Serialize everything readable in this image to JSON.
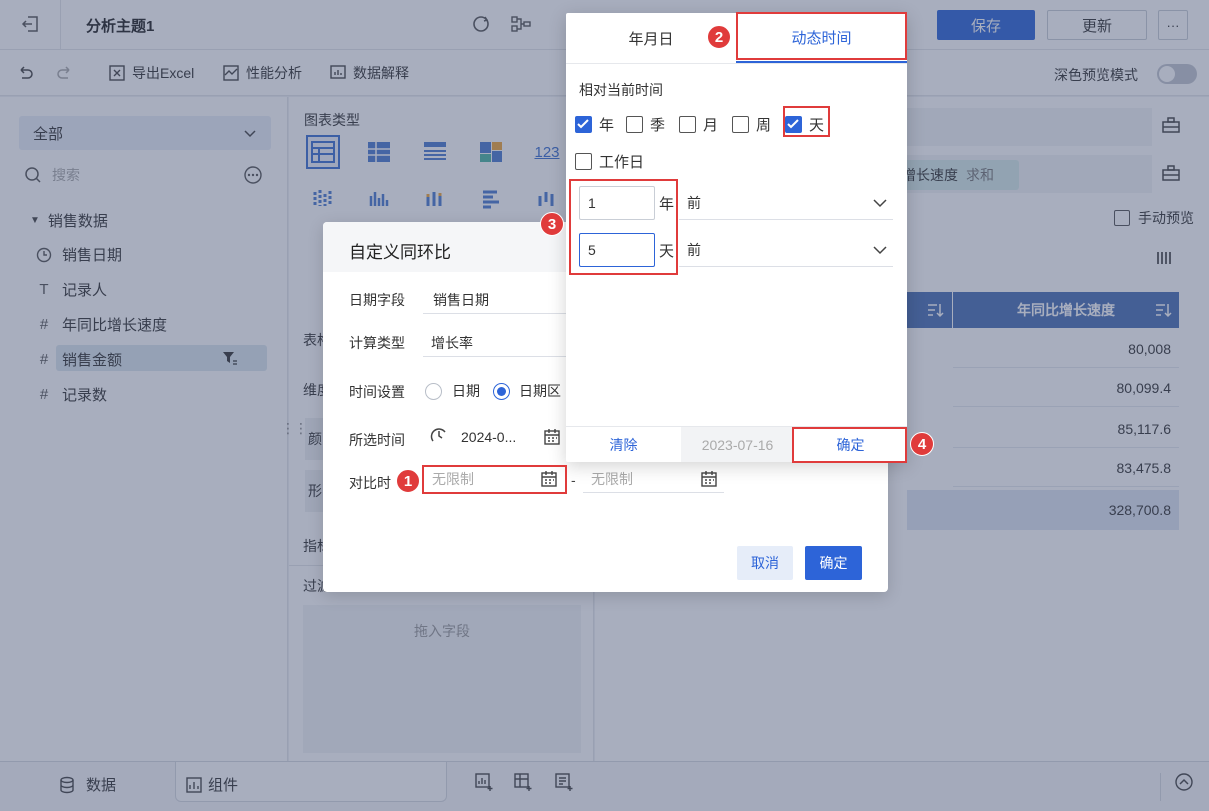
{
  "app": {
    "title": "分析主题1",
    "save": "保存",
    "update": "更新",
    "more": "···"
  },
  "toolbar": {
    "export_excel": "导出Excel",
    "perf": "性能分析",
    "explain": "数据解释",
    "dark_preview": "深色预览模式"
  },
  "left": {
    "scope": "全部",
    "search_placeholder": "搜索",
    "dataset": "销售数据",
    "fields": [
      {
        "icon": "date-icon",
        "label": "销售日期"
      },
      {
        "icon": "text-icon",
        "label": "记录人"
      },
      {
        "icon": "number-icon",
        "label": "年同比增长速度"
      },
      {
        "icon": "number-icon",
        "label": "销售金额"
      },
      {
        "icon": "number-star-icon",
        "label": "记录数"
      }
    ]
  },
  "middle": {
    "chart_type": "图表类型",
    "table_attr": "表格",
    "dims": "维度",
    "color": "颜",
    "shape": "形",
    "indicator": "指标",
    "filter": "过滤",
    "drop_field": "拖入字段"
  },
  "right": {
    "pill_text": "增长速度",
    "pill_agg": "求和",
    "manual_preview": "手动预览",
    "col_header": "年同比增长速度",
    "rows": [
      "80,008",
      "80,099.4",
      "85,117.6",
      "83,475.8",
      "328,700.8"
    ]
  },
  "bottom": {
    "data_tab": "数据",
    "component_tab": "组件"
  },
  "dialog": {
    "title": "自定义同环比",
    "date_field_label": "日期字段",
    "date_field_value": "销售日期",
    "calc_type_label": "计算类型",
    "calc_type_value": "增长率",
    "time_setting_label": "时间设置",
    "radio_date": "日期",
    "radio_range": "日期区",
    "selected_time_label": "所选时间",
    "selected_time_value": "2024-0...",
    "compare_time_label": "对比时",
    "compare_from": "无限制",
    "compare_to": "无限制",
    "dash": "-",
    "cancel": "取消",
    "ok": "确定"
  },
  "popover": {
    "tab_ymd": "年月日",
    "tab_dynamic": "动态时间",
    "relative_label": "相对当前时间",
    "units": [
      {
        "label": "年",
        "checked": true
      },
      {
        "label": "季",
        "checked": false
      },
      {
        "label": "月",
        "checked": false
      },
      {
        "label": "周",
        "checked": false
      },
      {
        "label": "天",
        "checked": true
      }
    ],
    "workday": "工作日",
    "year_value": "1",
    "year_unit": "年",
    "year_dir": "前",
    "day_value": "5",
    "day_unit": "天",
    "day_dir": "前",
    "clear": "清除",
    "date_preview": "2023-07-16",
    "confirm": "确定"
  },
  "annotations": [
    "1",
    "2",
    "3",
    "4"
  ]
}
